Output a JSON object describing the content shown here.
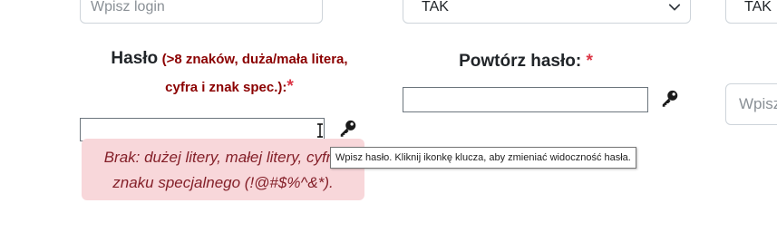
{
  "top_row": {
    "login_placeholder": "Wpisz login",
    "select_value": "TAK",
    "select2_value": "TAK"
  },
  "password": {
    "label": "Hasło",
    "hint_line1": "(>8 znaków, duża/mała litera,",
    "hint_line2": "cyfra i znak spec.):",
    "required_star": "*",
    "value": "",
    "toggle_icon": "key-icon",
    "error_line1": "Brak: dużej litery, małej litery, cyfry,",
    "error_line2": "znaku specjalnego (!@#$%^&*)."
  },
  "repeat_password": {
    "label": "Powtórz hasło:",
    "required_star": "*",
    "value": "",
    "toggle_icon": "key-icon"
  },
  "right_field": {
    "placeholder": "Wpisz"
  },
  "tooltip": {
    "text": "Wpisz hasło. Kliknij ikonkę klucza, aby zmieniać widoczność hasła."
  },
  "colors": {
    "error_bg": "#f8d7da",
    "error_text": "#842029",
    "hint_text": "#8b0000",
    "required": "#dc3545"
  }
}
